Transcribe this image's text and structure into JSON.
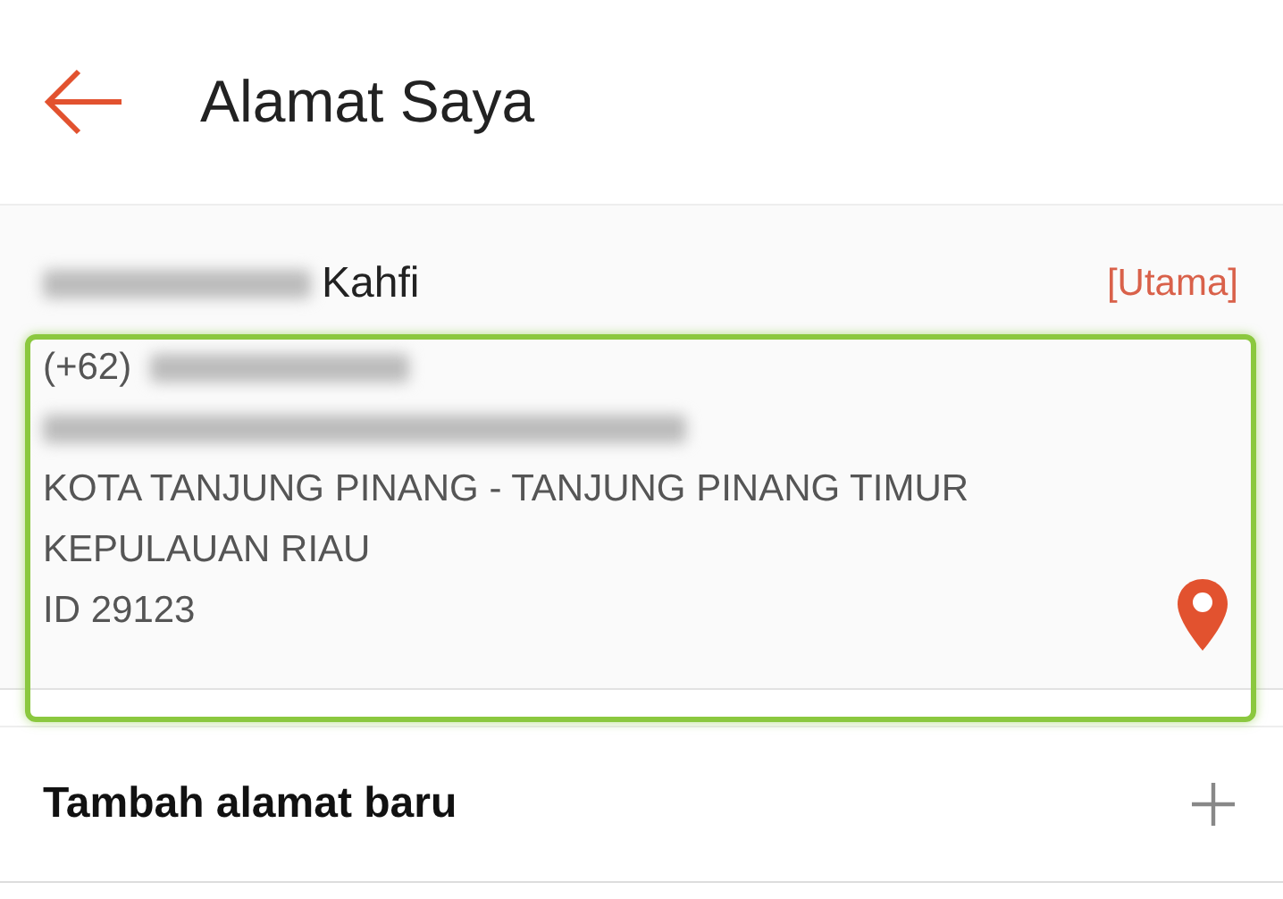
{
  "header": {
    "title": "Alamat Saya"
  },
  "address": {
    "name": "Kahfi",
    "badge": "[Utama]",
    "phone_prefix": "(+62)",
    "lines": [
      "KOTA TANJUNG PINANG - TANJUNG PINANG TIMUR",
      "KEPULAUAN RIAU",
      "ID 29123"
    ],
    "highlighted": true
  },
  "add_address": {
    "label": "Tambah alamat baru"
  }
}
